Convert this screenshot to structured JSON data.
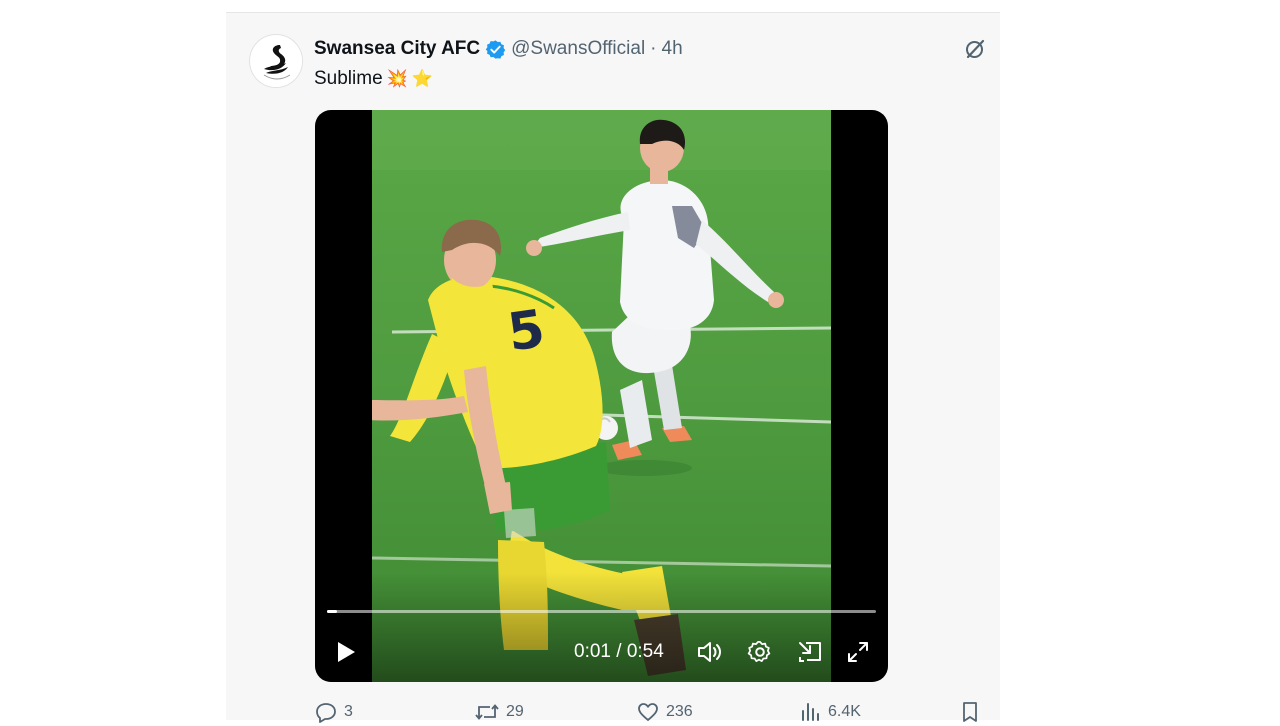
{
  "tweet": {
    "display_name": "Swansea City AFC",
    "handle": "@SwansOfficial",
    "separator": "·",
    "time": "4h",
    "text": "Sublime",
    "emojis": [
      "💥",
      "⭐"
    ],
    "icons": {
      "avatar": "swansea-swan-crest",
      "verified": "verified-badge-icon",
      "grok": "grok-icon"
    }
  },
  "video": {
    "current_time": "0:01",
    "duration": "0:54",
    "time_separator": " / ",
    "progress": 0.018,
    "controls": [
      "play-icon",
      "volume-icon",
      "settings-icon",
      "picture-in-picture-icon",
      "fullscreen-icon"
    ]
  },
  "actions": {
    "replies": "3",
    "reposts": "29",
    "likes": "236",
    "views": "6.4K"
  },
  "colors": {
    "verified_blue": "#1d9bf0",
    "text_primary": "#0f1419",
    "text_secondary": "#536471",
    "pitch_green": "#4f9b3f",
    "norwich_yellow": "#f4e53a",
    "norwich_green": "#3a9b35"
  }
}
